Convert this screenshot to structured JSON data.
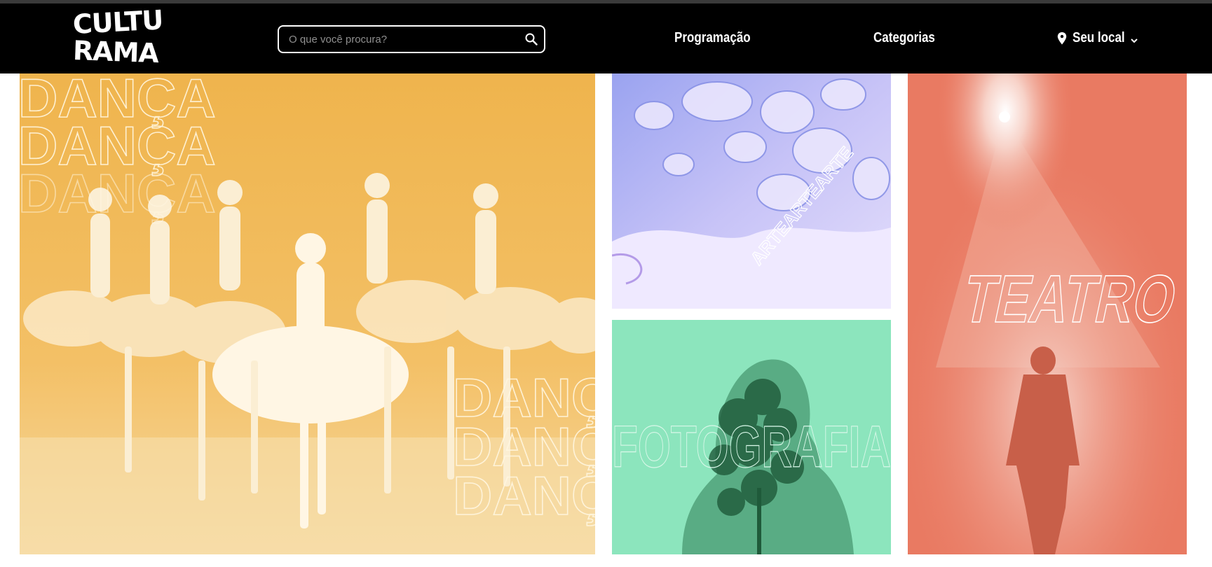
{
  "header": {
    "logo_line1": "CULTU",
    "logo_line2": "RAMA",
    "search_placeholder": "O que você procura?",
    "search_value": "",
    "nav": {
      "programacao": "Programação",
      "categorias": "Categorias",
      "seu_local": "Seu local"
    },
    "icons": {
      "search": "search-icon",
      "location": "location-pin-icon",
      "dropdown": "chevron-down-icon"
    }
  },
  "categories": [
    {
      "key": "danca",
      "label": "DANÇA",
      "color": "#f2bb53"
    },
    {
      "key": "arte",
      "label": "ARTE",
      "color": "#bcb8f2"
    },
    {
      "key": "fotografia",
      "label": "FOTOGRAFIA",
      "color": "#8ce5bd"
    },
    {
      "key": "teatro",
      "label": "TEATRO",
      "color": "#e97a62"
    }
  ],
  "colors": {
    "header_bg": "#000000",
    "text_on_header": "#ffffff"
  }
}
